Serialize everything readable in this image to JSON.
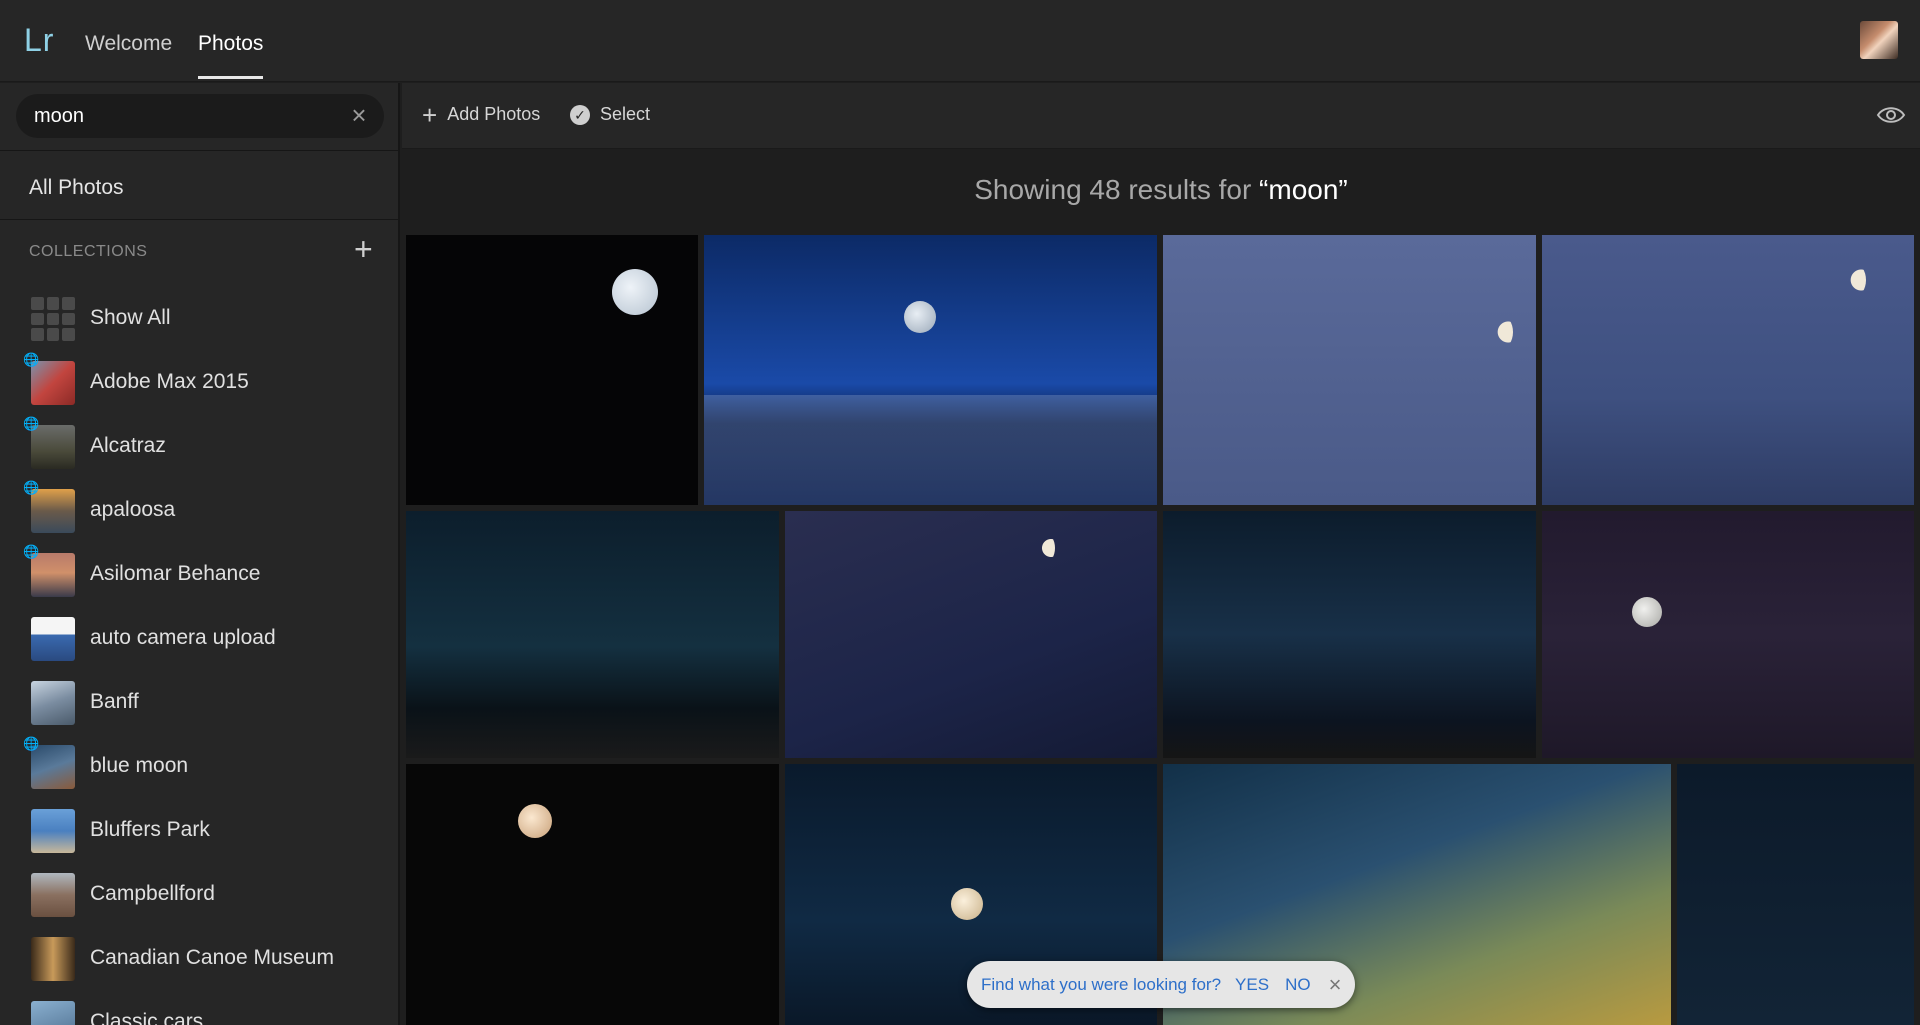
{
  "app": {
    "logo": "Lr"
  },
  "nav": {
    "tabs": [
      {
        "label": "Welcome"
      },
      {
        "label": "Photos"
      }
    ]
  },
  "search": {
    "value": "moon"
  },
  "sidebar": {
    "all_photos": "All Photos",
    "collections_heading": "COLLECTIONS",
    "collections": [
      {
        "name": "Show All",
        "shared": false
      },
      {
        "name": "Adobe Max 2015",
        "shared": true,
        "thumb_color": "#c2453f"
      },
      {
        "name": "Alcatraz",
        "shared": true,
        "thumb_color": "#5d5a4a"
      },
      {
        "name": "apaloosa",
        "shared": true,
        "thumb_color": "#7a6a4a"
      },
      {
        "name": "Asilomar Behance",
        "shared": true,
        "thumb_color": "#9a6a5a"
      },
      {
        "name": "auto camera upload",
        "shared": false,
        "thumb_color": "#e8eef5"
      },
      {
        "name": "Banff",
        "shared": false,
        "thumb_color": "#8a9cae"
      },
      {
        "name": "blue moon",
        "shared": true,
        "thumb_color": "#3a5a7a"
      },
      {
        "name": "Bluffers Park",
        "shared": false,
        "thumb_color": "#5a8ab8"
      },
      {
        "name": "Campbellford",
        "shared": false,
        "thumb_color": "#9a8a7a"
      },
      {
        "name": "Canadian Canoe Museum",
        "shared": false,
        "thumb_color": "#7a5a3a"
      },
      {
        "name": "Classic cars",
        "shared": false,
        "thumb_color": "#4a6a8a"
      }
    ]
  },
  "toolbar": {
    "add_photos": "Add Photos",
    "select": "Select"
  },
  "results": {
    "prefix": "Showing 48 results for ",
    "query": "“moon”"
  },
  "feedback": {
    "question": "Find what you were looking for?",
    "yes": "YES",
    "no": "NO"
  },
  "colors": {
    "accent_logo": "#8fd1e6",
    "feedback_link": "#2d6fc9",
    "background": "#1e1e1e"
  }
}
